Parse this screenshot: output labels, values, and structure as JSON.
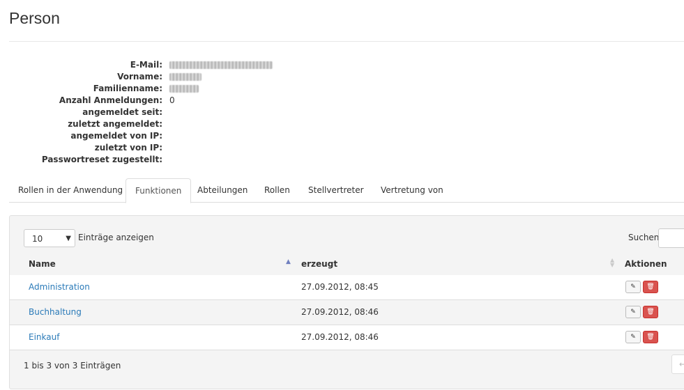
{
  "page": {
    "title": "Person"
  },
  "details": [
    {
      "label": "E-Mail:",
      "value": ""
    },
    {
      "label": "Vorname:",
      "value": ""
    },
    {
      "label": "Familienname:",
      "value": ""
    },
    {
      "label": "Anzahl Anmeldungen:",
      "value": "0"
    },
    {
      "label": "angemeldet seit:",
      "value": ""
    },
    {
      "label": "zuletzt angemeldet:",
      "value": ""
    },
    {
      "label": "angemeldet von IP:",
      "value": ""
    },
    {
      "label": "zuletzt von IP:",
      "value": ""
    },
    {
      "label": "Passwortreset zugestellt:",
      "value": ""
    }
  ],
  "tabs": [
    {
      "label": "Rollen in der Anwendung",
      "active": false
    },
    {
      "label": "Funktionen",
      "active": true
    },
    {
      "label": "Abteilungen",
      "active": false
    },
    {
      "label": "Rollen",
      "active": false
    },
    {
      "label": "Stellvertreter",
      "active": false
    },
    {
      "label": "Vertretung von",
      "active": false
    }
  ],
  "table_controls": {
    "length_value": "10",
    "length_label": "Einträge anzeigen",
    "search_label": "Suchen",
    "search_value": ""
  },
  "table": {
    "columns": [
      "Name",
      "erzeugt",
      "Aktionen"
    ],
    "rows": [
      {
        "name": "Administration",
        "created": "27.09.2012, 08:45"
      },
      {
        "name": "Buchhaltung",
        "created": "27.09.2012, 08:46"
      },
      {
        "name": "Einkauf",
        "created": "27.09.2012, 08:46"
      }
    ],
    "info": "1 bis 3 von 3 Einträgen",
    "pagination_prev": "←"
  },
  "icons": {
    "edit": "edit-icon",
    "delete": "trash-icon",
    "sort_asc": "sort-asc-icon",
    "sort_both": "sort-both-icon",
    "dropdown": "caret-down-icon"
  },
  "colors": {
    "link": "#2a7ab8",
    "delete_button": "#d9534f",
    "panel_bg": "#f4f4f4"
  }
}
